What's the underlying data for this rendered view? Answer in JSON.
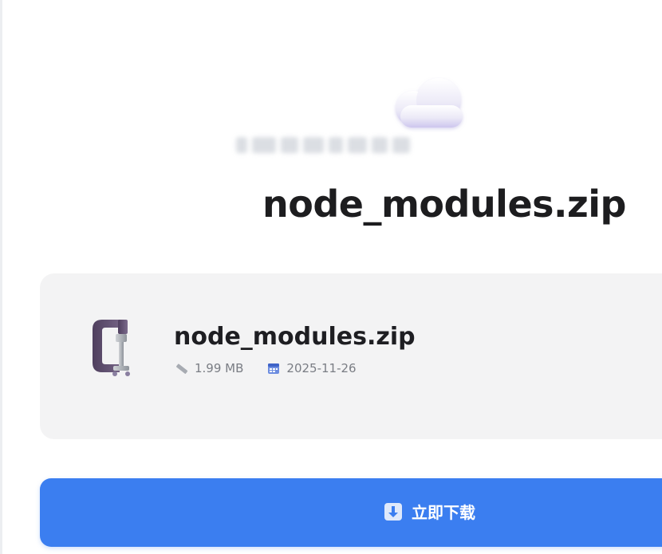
{
  "page": {
    "title": "node_modules.zip"
  },
  "file": {
    "name": "node_modules.zip",
    "size": "1.99 MB",
    "date": "2025-11-26",
    "icon": "archive-clamp-icon"
  },
  "actions": {
    "download_label": "立即下载",
    "download_icon": "download-arrow-icon"
  },
  "decor": {
    "cloud_icon": "cloud-icon"
  },
  "colors": {
    "accent": "#3b7ef0",
    "card_bg": "#f3f3f4",
    "title": "#1d1d1f"
  }
}
